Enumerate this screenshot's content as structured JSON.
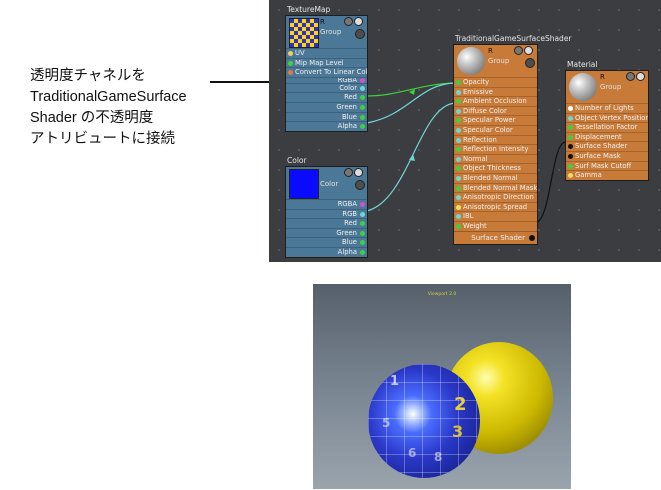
{
  "callout": {
    "line1": "透明度チャネルを",
    "line2": "TraditionalGameSurface",
    "line3": "Shader の不透明度",
    "line4": "アトリビュートに接続"
  },
  "texturemap_node": {
    "title": "TextureMap",
    "header_r": "R",
    "group_label": "Group",
    "inputs": [
      "UV",
      "Mip Map Level",
      "Convert To Linear Color"
    ],
    "outputs": [
      "RGBA",
      "Color",
      "Red",
      "Green",
      "Blue",
      "Alpha"
    ]
  },
  "color_node": {
    "title": "Color",
    "header_label": "Color",
    "swatch_color": "#0a0aff",
    "outputs": [
      "RGBA",
      "RGB",
      "Red",
      "Green",
      "Blue",
      "Alpha"
    ]
  },
  "shader_node": {
    "title": "TraditionalGameSurfaceShader",
    "header_r": "R",
    "group_label": "Group",
    "inputs": [
      "Opacity",
      "Emissive",
      "Ambient Occlusion",
      "Diffuse Color",
      "Specular Power",
      "Specular Color",
      "Reflection",
      "Reflection Intensity",
      "Normal",
      "Object Thickness",
      "Blended Normal",
      "Blended Normal Mask",
      "Anisotropic Direction",
      "Anisotropic Spread",
      "IBL",
      "Weight"
    ],
    "output": "Surface Shader"
  },
  "material_node": {
    "title": "Material",
    "header_r": "R",
    "group_label": "Group",
    "inputs": [
      "Number of Lights",
      "Object Vertex Position",
      "Tessellation Factor",
      "Displacement",
      "Surface Shader",
      "Surface Mask",
      "Surf Mask Cutoff",
      "Gamma"
    ]
  },
  "viewport": {
    "title": "Viewport 2.0",
    "numerals": [
      "1",
      "2",
      "3",
      "5",
      "6",
      "8"
    ]
  },
  "colors": {
    "editor_bg": "#3b3d40",
    "node_blue": "#4c7897",
    "node_orange": "#c87a38",
    "wire": "#6fd6d6",
    "wire_green": "#3fd03f"
  }
}
